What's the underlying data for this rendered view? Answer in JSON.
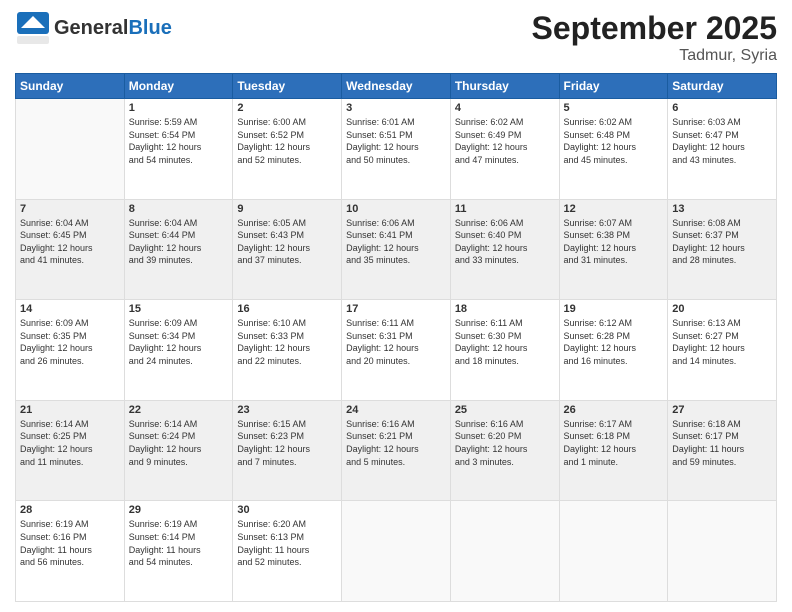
{
  "header": {
    "logo_general": "General",
    "logo_blue": "Blue",
    "title": "September 2025",
    "subtitle": "Tadmur, Syria"
  },
  "calendar": {
    "headers": [
      "Sunday",
      "Monday",
      "Tuesday",
      "Wednesday",
      "Thursday",
      "Friday",
      "Saturday"
    ],
    "rows": [
      [
        {
          "day": "",
          "info": ""
        },
        {
          "day": "1",
          "info": "Sunrise: 5:59 AM\nSunset: 6:54 PM\nDaylight: 12 hours\nand 54 minutes."
        },
        {
          "day": "2",
          "info": "Sunrise: 6:00 AM\nSunset: 6:52 PM\nDaylight: 12 hours\nand 52 minutes."
        },
        {
          "day": "3",
          "info": "Sunrise: 6:01 AM\nSunset: 6:51 PM\nDaylight: 12 hours\nand 50 minutes."
        },
        {
          "day": "4",
          "info": "Sunrise: 6:02 AM\nSunset: 6:49 PM\nDaylight: 12 hours\nand 47 minutes."
        },
        {
          "day": "5",
          "info": "Sunrise: 6:02 AM\nSunset: 6:48 PM\nDaylight: 12 hours\nand 45 minutes."
        },
        {
          "day": "6",
          "info": "Sunrise: 6:03 AM\nSunset: 6:47 PM\nDaylight: 12 hours\nand 43 minutes."
        }
      ],
      [
        {
          "day": "7",
          "info": "Sunrise: 6:04 AM\nSunset: 6:45 PM\nDaylight: 12 hours\nand 41 minutes."
        },
        {
          "day": "8",
          "info": "Sunrise: 6:04 AM\nSunset: 6:44 PM\nDaylight: 12 hours\nand 39 minutes."
        },
        {
          "day": "9",
          "info": "Sunrise: 6:05 AM\nSunset: 6:43 PM\nDaylight: 12 hours\nand 37 minutes."
        },
        {
          "day": "10",
          "info": "Sunrise: 6:06 AM\nSunset: 6:41 PM\nDaylight: 12 hours\nand 35 minutes."
        },
        {
          "day": "11",
          "info": "Sunrise: 6:06 AM\nSunset: 6:40 PM\nDaylight: 12 hours\nand 33 minutes."
        },
        {
          "day": "12",
          "info": "Sunrise: 6:07 AM\nSunset: 6:38 PM\nDaylight: 12 hours\nand 31 minutes."
        },
        {
          "day": "13",
          "info": "Sunrise: 6:08 AM\nSunset: 6:37 PM\nDaylight: 12 hours\nand 28 minutes."
        }
      ],
      [
        {
          "day": "14",
          "info": "Sunrise: 6:09 AM\nSunset: 6:35 PM\nDaylight: 12 hours\nand 26 minutes."
        },
        {
          "day": "15",
          "info": "Sunrise: 6:09 AM\nSunset: 6:34 PM\nDaylight: 12 hours\nand 24 minutes."
        },
        {
          "day": "16",
          "info": "Sunrise: 6:10 AM\nSunset: 6:33 PM\nDaylight: 12 hours\nand 22 minutes."
        },
        {
          "day": "17",
          "info": "Sunrise: 6:11 AM\nSunset: 6:31 PM\nDaylight: 12 hours\nand 20 minutes."
        },
        {
          "day": "18",
          "info": "Sunrise: 6:11 AM\nSunset: 6:30 PM\nDaylight: 12 hours\nand 18 minutes."
        },
        {
          "day": "19",
          "info": "Sunrise: 6:12 AM\nSunset: 6:28 PM\nDaylight: 12 hours\nand 16 minutes."
        },
        {
          "day": "20",
          "info": "Sunrise: 6:13 AM\nSunset: 6:27 PM\nDaylight: 12 hours\nand 14 minutes."
        }
      ],
      [
        {
          "day": "21",
          "info": "Sunrise: 6:14 AM\nSunset: 6:25 PM\nDaylight: 12 hours\nand 11 minutes."
        },
        {
          "day": "22",
          "info": "Sunrise: 6:14 AM\nSunset: 6:24 PM\nDaylight: 12 hours\nand 9 minutes."
        },
        {
          "day": "23",
          "info": "Sunrise: 6:15 AM\nSunset: 6:23 PM\nDaylight: 12 hours\nand 7 minutes."
        },
        {
          "day": "24",
          "info": "Sunrise: 6:16 AM\nSunset: 6:21 PM\nDaylight: 12 hours\nand 5 minutes."
        },
        {
          "day": "25",
          "info": "Sunrise: 6:16 AM\nSunset: 6:20 PM\nDaylight: 12 hours\nand 3 minutes."
        },
        {
          "day": "26",
          "info": "Sunrise: 6:17 AM\nSunset: 6:18 PM\nDaylight: 12 hours\nand 1 minute."
        },
        {
          "day": "27",
          "info": "Sunrise: 6:18 AM\nSunset: 6:17 PM\nDaylight: 11 hours\nand 59 minutes."
        }
      ],
      [
        {
          "day": "28",
          "info": "Sunrise: 6:19 AM\nSunset: 6:16 PM\nDaylight: 11 hours\nand 56 minutes."
        },
        {
          "day": "29",
          "info": "Sunrise: 6:19 AM\nSunset: 6:14 PM\nDaylight: 11 hours\nand 54 minutes."
        },
        {
          "day": "30",
          "info": "Sunrise: 6:20 AM\nSunset: 6:13 PM\nDaylight: 11 hours\nand 52 minutes."
        },
        {
          "day": "",
          "info": ""
        },
        {
          "day": "",
          "info": ""
        },
        {
          "day": "",
          "info": ""
        },
        {
          "day": "",
          "info": ""
        }
      ]
    ]
  }
}
